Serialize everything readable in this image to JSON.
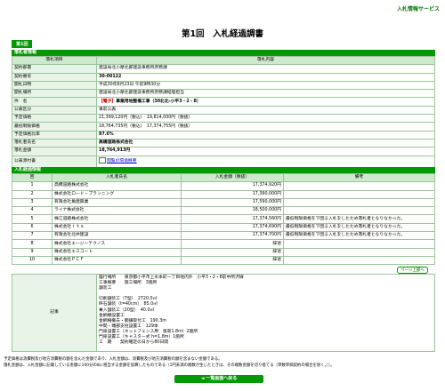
{
  "service_title": "入札情報サービス",
  "page_title": "第1回　入札経過調書",
  "round_tab": "第1回",
  "summary": {
    "section_title": "落札者情報",
    "col_item": "落札項目",
    "col_content": "落札内容",
    "rows": [
      {
        "label": "契約部署",
        "value": "建設局北小摩北部建設事務所庶務課"
      },
      {
        "label": "契約番号",
        "value": "30-00122"
      },
      {
        "label": "開札日時",
        "value": "平成30年8月23日 午前9時30分"
      },
      {
        "label": "開札場所",
        "value": "建設局北小摩北部建設事務所庶務課経理担当"
      },
      {
        "label": "件　名",
        "tag": "【電子】",
        "value": "事業用地整備工事（30北北-小平3・2・8）"
      },
      {
        "label": "公表区分",
        "value": "事前公表"
      },
      {
        "label": "予定価格",
        "value": "21,399,120円（税込）　19,814,000円（税抜）"
      },
      {
        "label": "最低制限価格",
        "value": "18,764,735円（税込）　17,374,755円（税抜）"
      },
      {
        "label": "予定価格比率",
        "value": "87.6%"
      },
      {
        "label": "落札者氏名",
        "value": "高橋道路株式会社"
      },
      {
        "label": "落札金額",
        "value": "18,764,913円"
      },
      {
        "label": "公表添付書",
        "link": "閲覧の環境概要"
      }
    ]
  },
  "bids": {
    "section_title": "入札経過情報",
    "headers": [
      "回",
      "入札者氏名",
      "入札金額（税抜）",
      "備考"
    ],
    "rows": [
      {
        "no": "1",
        "name": "高橋道路株式会社",
        "amount": "17,374,920円",
        "note": ""
      },
      {
        "no": "2",
        "name": "株式会社ロード・プランニング",
        "amount": "17,390,000円",
        "note": ""
      },
      {
        "no": "3",
        "name": "有限会社角建興業",
        "amount": "17,590,000円",
        "note": ""
      },
      {
        "no": "4",
        "name": "ライナ株式会社",
        "amount": "18,500,000円",
        "note": ""
      },
      {
        "no": "5",
        "name": "株江道路株式会社",
        "amount": "17,374,560円",
        "note": "最低制限価格を下回る入札をしたため落札者となりなかった。"
      },
      {
        "no": "6",
        "name": "株式会社ｉｔｓ",
        "amount": "17,374,690円",
        "note": "最低制限価格を下回る入札をしたため落札者となりなかった。"
      },
      {
        "no": "7",
        "name": "有限会社北井建設",
        "amount": "17,374,700円",
        "note": "最低制限価格を下回る入札をしたため落札者となりなかった。"
      },
      {
        "no": "8",
        "name": "株式会社エージーテクノス",
        "amount": "辞退",
        "note": ""
      },
      {
        "no": "9",
        "name": "株式会社エスコート",
        "amount": "辞退",
        "note": ""
      },
      {
        "no": "10",
        "name": "株式会社ＰＣＦ",
        "amount": "辞退",
        "note": ""
      }
    ]
  },
  "page_top_button": "ページ上部へ",
  "remarks": {
    "label": "記事",
    "text": "履行場所　　東京都小平市上水本町一丁目地内外　小平3・2・8前中所沢線\n工事概要　　施工場所　3箇所\n舗装工\n　　　　\n切削舗装工（7型）　2720.0㎡\n砕石舗装（t=40cm）　85.0㎡\n乗入舗装工（20型）　40.0㎡\n金網棚設置工\n金網柵撤去・胴鎌取付工　190.3m\n中間・端部支柱設置工　129本\n門扉設置工（ネットフェンス用　張高1.8m）2箇所\n門扉設置工（キャスター式 h=1.8m）1箇所\n工　期　　契約確定の日から80日間"
  },
  "notes": [
    "予定価格は消費税及び地方消費税の額を含んだ金額であり、入札金額は、消費税及び地方消費税の額を含まない金額である。",
    "落札金額は、入札金額に記載している金額に100分の8に相当する金額を加算したものである（1円未満の端数が生じたときは、その端数金額を切り捨てる（単数単価契約の場合を除く。））。"
  ],
  "back_button": "◄ 一覧画面へ戻る"
}
